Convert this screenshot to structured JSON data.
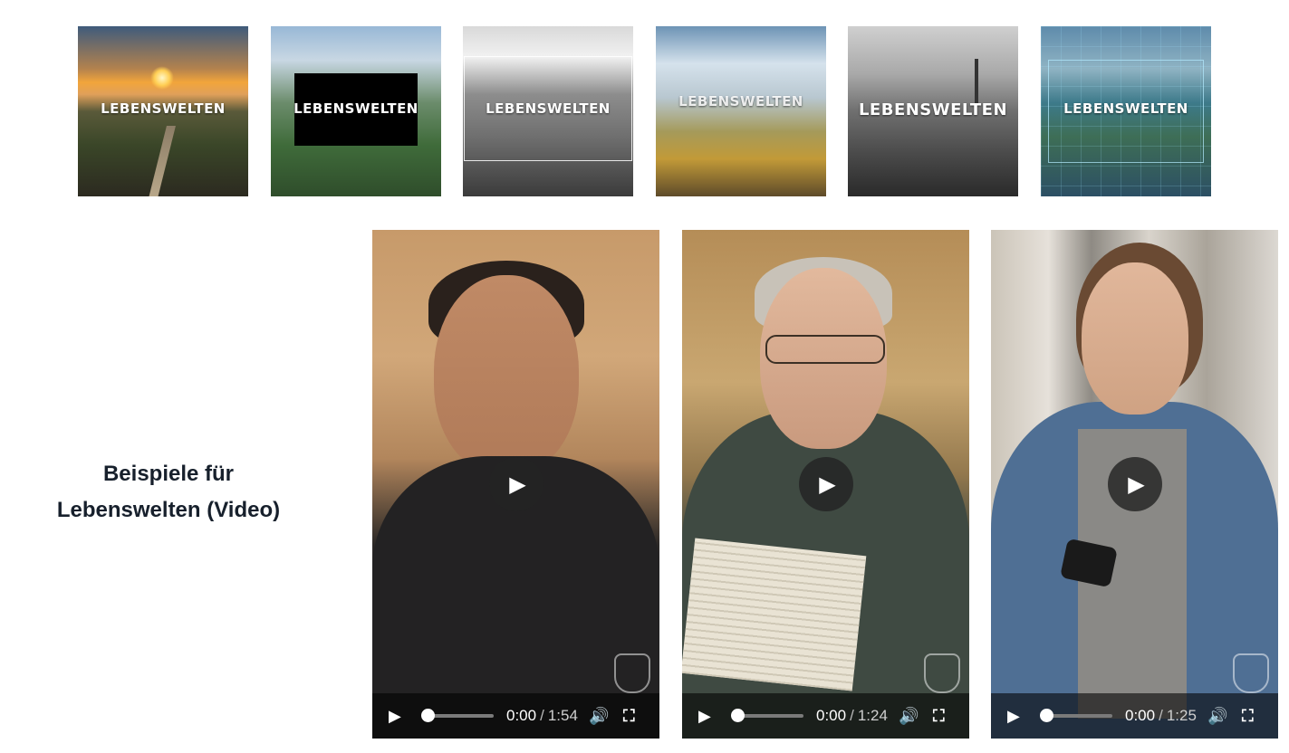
{
  "thumbnails": [
    {
      "label": "LEBENSWELTEN"
    },
    {
      "label": "LEBENSWELTEN"
    },
    {
      "label": "LEBENSWELTEN"
    },
    {
      "label": "LEBENSWELTEN"
    },
    {
      "label": "LEBENSWELTEN"
    },
    {
      "label": "LEBENSWELTEN"
    }
  ],
  "section": {
    "title_line1": "Beispiele für",
    "title_line2": "Lebenswelten (Video)"
  },
  "videos": [
    {
      "current": "0:00",
      "separator": "/",
      "duration": "1:54",
      "progress": 0
    },
    {
      "current": "0:00",
      "separator": "/",
      "duration": "1:24",
      "progress": 0
    },
    {
      "current": "0:00",
      "separator": "/",
      "duration": "1:25",
      "progress": 0
    }
  ],
  "icons": {
    "play": "play-icon",
    "volume": "volume-icon",
    "fullscreen": "fullscreen-icon"
  }
}
